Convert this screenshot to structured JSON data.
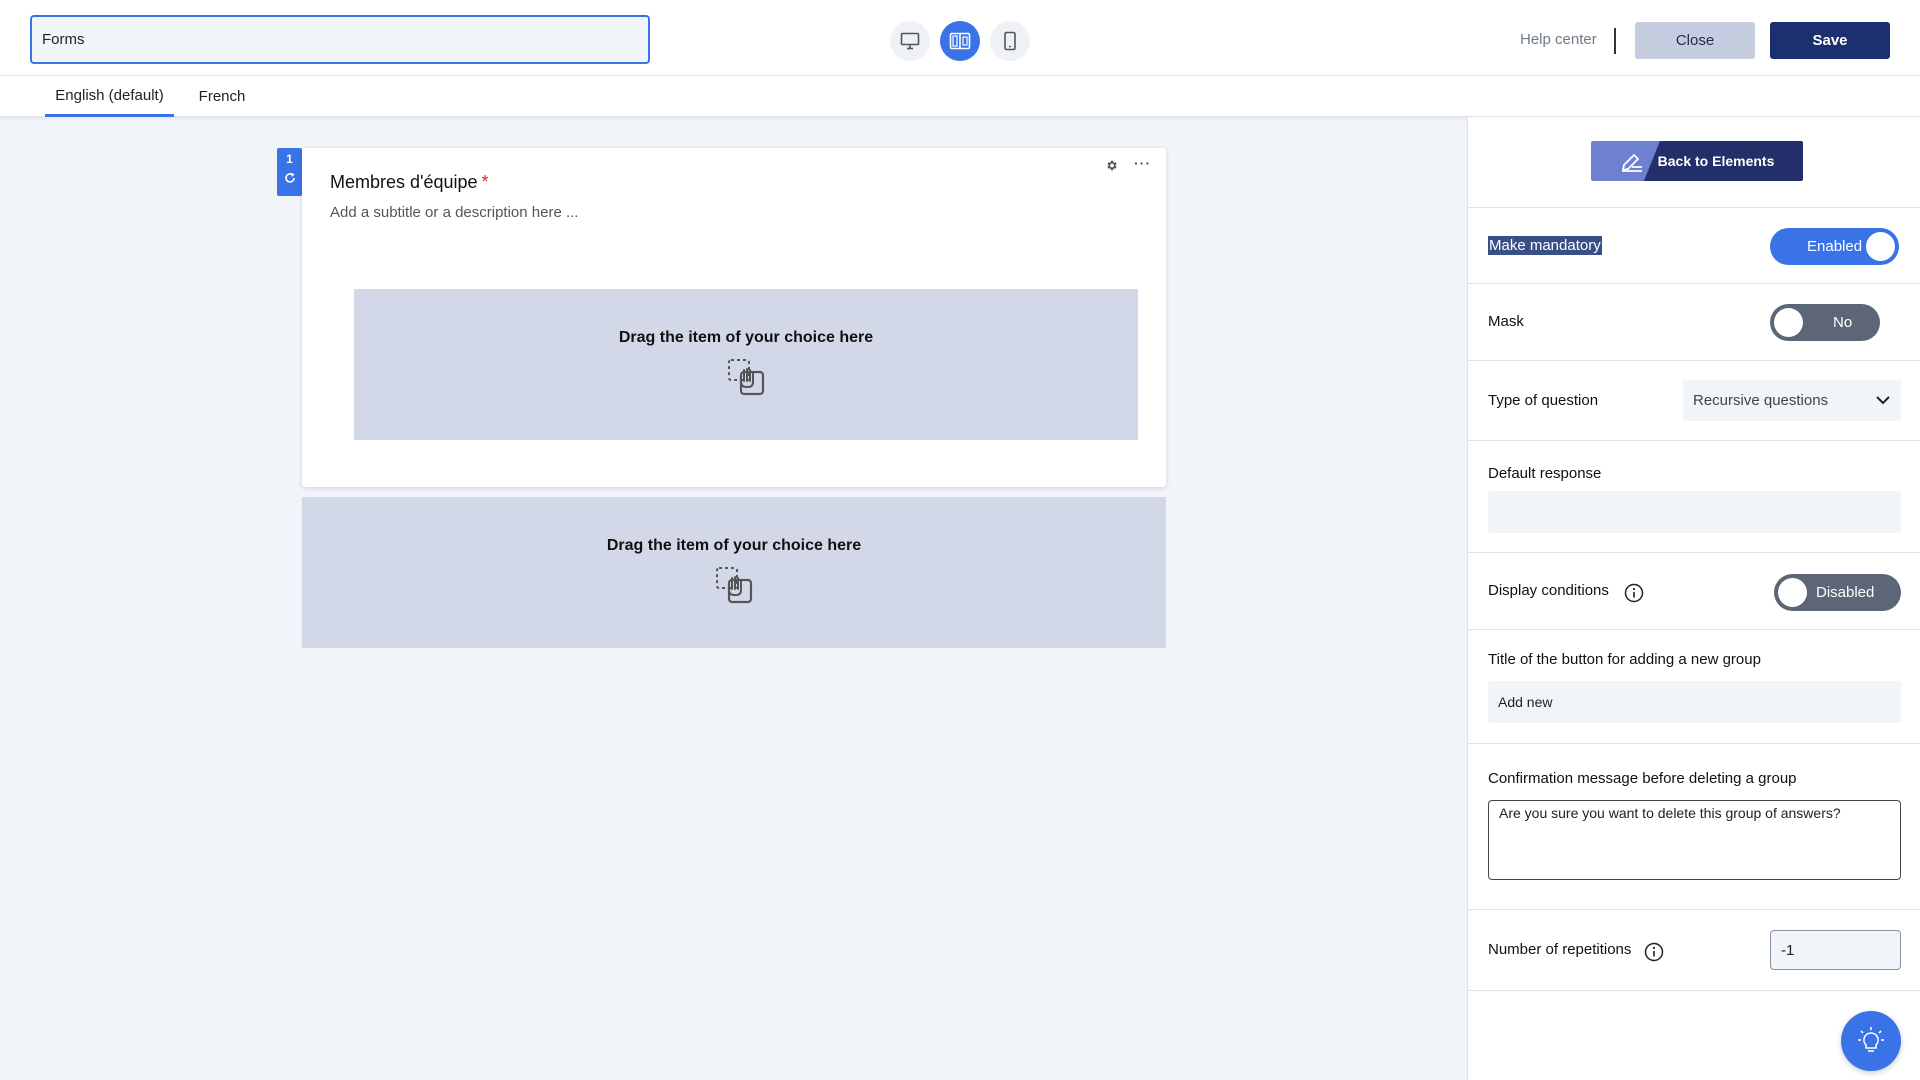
{
  "header": {
    "form_name": "Forms",
    "help_label": "Help center",
    "close_label": "Close",
    "save_label": "Save",
    "active_view": "split-view"
  },
  "language_tabs": [
    {
      "label": "English (default)",
      "active": true
    },
    {
      "label": "French",
      "active": false
    }
  ],
  "question": {
    "number": "1",
    "title": "Membres d'équipe",
    "required_marker": "*",
    "subtitle_placeholder": "Add a subtitle or a description here ...",
    "dropzone_label": "Drag the item of your choice here"
  },
  "canvas_dropzone_label": "Drag the item of your choice here",
  "panel": {
    "back_label": "Back to Elements",
    "mandatory": {
      "label": "Make mandatory",
      "state": "Enabled",
      "on": true
    },
    "mask": {
      "label": "Mask",
      "state": "No",
      "on": false
    },
    "question_type": {
      "label": "Type of question",
      "value": "Recursive questions"
    },
    "default_response": {
      "label": "Default response",
      "value": ""
    },
    "display_conditions": {
      "label": "Display conditions",
      "state": "Disabled",
      "on": false
    },
    "add_button_title": {
      "label": "Title of the button for adding a new group",
      "value": "Add new"
    },
    "delete_confirmation": {
      "label": "Confirmation message before deleting a group",
      "value": "Are you sure you want to delete this group of answers?"
    },
    "repetitions": {
      "label": "Number of repetitions",
      "value": "-1"
    }
  },
  "colors": {
    "accent": "#3a72e8",
    "primary_dark": "#1c2f6e",
    "dropzone": "#d3d8e9",
    "required": "#e0262b"
  }
}
